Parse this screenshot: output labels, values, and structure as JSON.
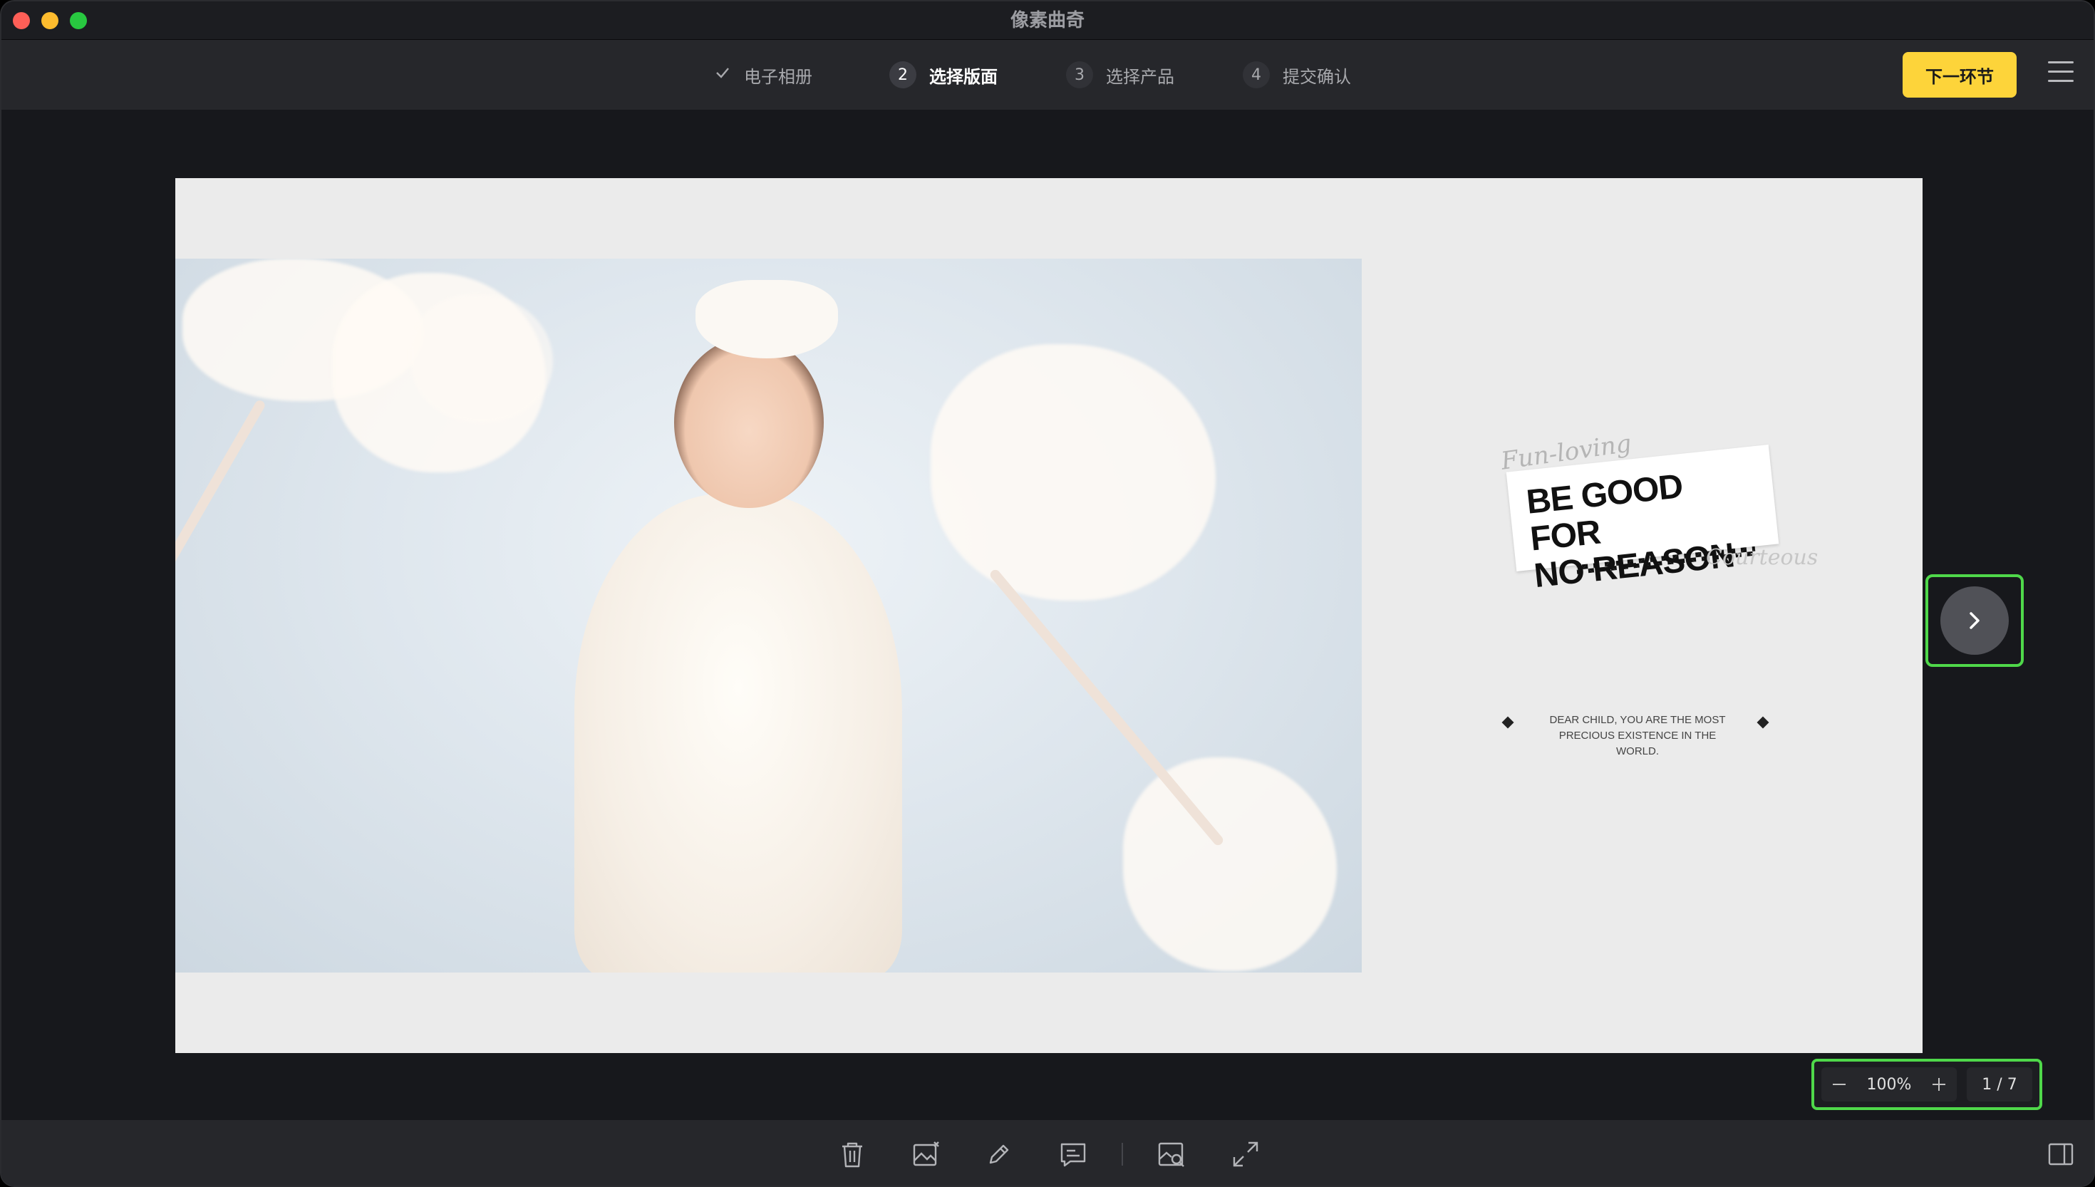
{
  "window": {
    "title": "像素曲奇"
  },
  "steps": [
    {
      "index": "✓",
      "label": "电子相册",
      "state": "done"
    },
    {
      "index": "2",
      "label": "选择版面",
      "state": "active"
    },
    {
      "index": "3",
      "label": "选择产品",
      "state": "pending"
    },
    {
      "index": "4",
      "label": "提交确认",
      "state": "pending"
    }
  ],
  "toolbar": {
    "next_label": "下一环节",
    "menu_icon": "hamburger-menu-icon"
  },
  "page": {
    "slogan_script_top": "Fun-loving",
    "slogan_main": "BE GOOD FOR NO REASON",
    "slogan_line1": "BE GOOD FOR",
    "slogan_line2": "NO REASON",
    "slogan_script_bottom": "Courteous",
    "caption": "DEAR CHILD, YOU ARE THE MOST PRECIOUS EXISTENCE IN THE WORLD."
  },
  "navigation": {
    "next_page_icon": "chevron-right-icon"
  },
  "zoom": {
    "value": "100%",
    "page_indicator": "1 / 7"
  },
  "bottom_tools": [
    "trash-icon",
    "replace-image-icon",
    "edit-pen-icon",
    "text-box-icon",
    "image-search-icon",
    "fullscreen-icon"
  ],
  "colors": {
    "accent": "#fdd43a",
    "highlight": "#4fd84a",
    "background": "#17181c",
    "toolbar": "#26272b"
  }
}
